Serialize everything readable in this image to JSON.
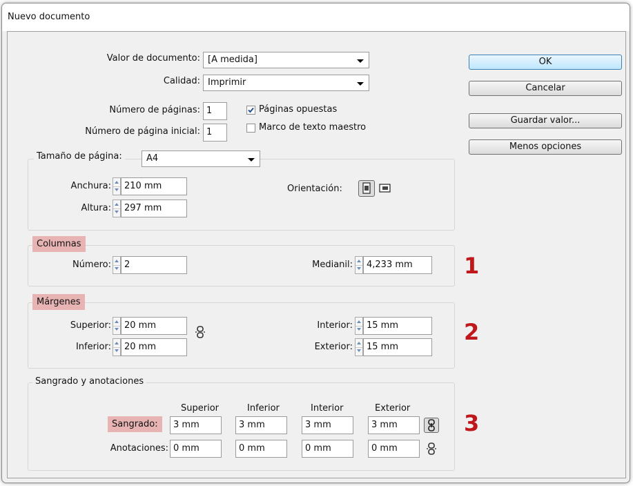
{
  "window": {
    "title": "Nuevo documento"
  },
  "valor": {
    "label": "Valor de documento:",
    "value": "[A medida]"
  },
  "calidad": {
    "label": "Calidad:",
    "value": "Imprimir"
  },
  "paginas": {
    "label": "Número de páginas:",
    "value": "1"
  },
  "pagina_inicial": {
    "label": "Número de página inicial:",
    "value": "1"
  },
  "paginas_opuestas": {
    "label": "Páginas opuestas",
    "checked": true
  },
  "marco_texto": {
    "label": "Marco de texto maestro",
    "checked": false
  },
  "buttons": {
    "ok": "OK",
    "cancelar": "Cancelar",
    "guardar": "Guardar valor...",
    "menos": "Menos opciones"
  },
  "tamano": {
    "label": "Tamaño de página:",
    "value": "A4",
    "anchura_label": "Anchura:",
    "anchura": "210 mm",
    "altura_label": "Altura:",
    "altura": "297 mm",
    "orientacion_label": "Orientación:"
  },
  "columnas": {
    "legend": "Columnas",
    "numero_label": "Número:",
    "numero": "2",
    "medianil_label": "Medianil:",
    "medianil": "4,233 mm",
    "badge": "1"
  },
  "margenes": {
    "legend": "Márgenes",
    "superior_label": "Superior:",
    "superior": "20 mm",
    "inferior_label": "Inferior:",
    "inferior": "20 mm",
    "interior_label": "Interior:",
    "interior": "15 mm",
    "exterior_label": "Exterior:",
    "exterior": "15 mm",
    "badge": "2"
  },
  "sangrado": {
    "legend": "Sangrado y anotaciones",
    "headers": [
      "Superior",
      "Inferior",
      "Interior",
      "Exterior"
    ],
    "sangrado_label": "Sangrado:",
    "sangrado_values": [
      "3 mm",
      "3 mm",
      "3 mm",
      "3 mm"
    ],
    "anotaciones_label": "Anotaciones:",
    "anotaciones_values": [
      "0 mm",
      "0 mm",
      "0 mm",
      "0 mm"
    ],
    "badge": "3"
  },
  "icons": {
    "chain": "chain-link-icon",
    "portrait": "portrait-orientation-icon",
    "landscape": "landscape-orientation-icon"
  }
}
